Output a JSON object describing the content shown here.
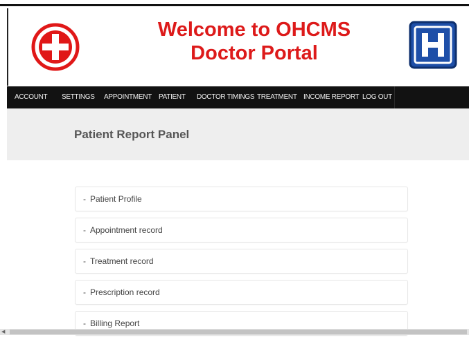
{
  "header": {
    "title_line1": "Welcome to OHCMS",
    "title_line2": "Doctor Portal",
    "left_logo": "red-cross-icon",
    "right_logo": "hospital-h-icon",
    "colors": {
      "title": "#dd1a1a",
      "hospital_blue": "#1e4fa8",
      "nav_bg": "#121212"
    }
  },
  "nav": {
    "items": [
      {
        "label": "ACCOUNT"
      },
      {
        "label": "SETTINGS"
      },
      {
        "label": "APPOINTMENT"
      },
      {
        "label": "PATIENT"
      },
      {
        "label": "DOCTOR TIMINGS"
      },
      {
        "label": "TREATMENT"
      },
      {
        "label": "INCOME REPORT"
      },
      {
        "label": "LOG OUT"
      }
    ]
  },
  "panel": {
    "title": "Patient Report Panel",
    "items": [
      {
        "label": "Patient Profile"
      },
      {
        "label": "Appointment record"
      },
      {
        "label": "Treatment record"
      },
      {
        "label": "Prescription record"
      },
      {
        "label": "Billing Report"
      }
    ],
    "bullet": "-"
  }
}
